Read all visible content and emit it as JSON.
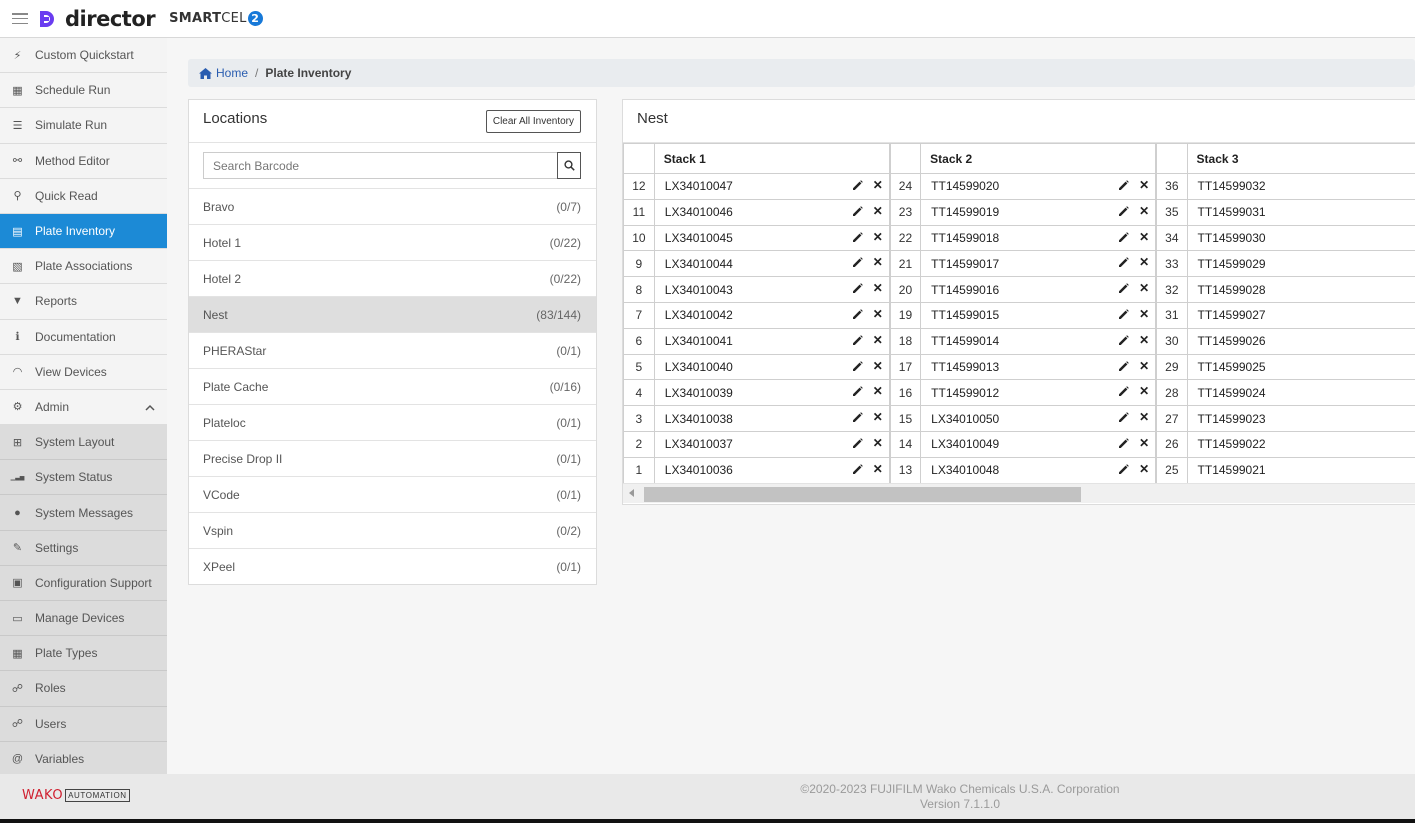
{
  "app": {
    "logo_text": "director",
    "product_name_bold": "SMART",
    "product_name_light": "CEL",
    "product_version_mark": "2"
  },
  "sidebar": {
    "items": [
      {
        "label": "Custom Quickstart",
        "icon": "bolt-icon",
        "glyph": "⚡"
      },
      {
        "label": "Schedule Run",
        "icon": "calendar-icon",
        "glyph": "▦"
      },
      {
        "label": "Simulate Run",
        "icon": "list-icon",
        "glyph": "☰"
      },
      {
        "label": "Method Editor",
        "icon": "sitemap-icon",
        "glyph": "⚯"
      },
      {
        "label": "Quick Read",
        "icon": "binoculars-icon",
        "glyph": "⚲"
      },
      {
        "label": "Plate Inventory",
        "icon": "inventory-icon",
        "glyph": "▤",
        "active": true
      },
      {
        "label": "Plate Associations",
        "icon": "file-icon",
        "glyph": "▧"
      },
      {
        "label": "Reports",
        "icon": "filter-icon",
        "glyph": "▼"
      },
      {
        "label": "Documentation",
        "icon": "info-icon",
        "glyph": "ℹ"
      },
      {
        "label": "View Devices",
        "icon": "wifi-icon",
        "glyph": "◠"
      },
      {
        "label": "Admin",
        "icon": "gear-icon",
        "glyph": "⚙",
        "expanded": true
      },
      {
        "label": "System Layout",
        "icon": "network-icon",
        "glyph": "⊞",
        "sub": true
      },
      {
        "label": "System Status",
        "icon": "signal-icon",
        "glyph": "▁▃▅",
        "sub": true
      },
      {
        "label": "System Messages",
        "icon": "comment-icon",
        "glyph": "●",
        "sub": true
      },
      {
        "label": "Settings",
        "icon": "wrench-icon",
        "glyph": "✎",
        "sub": true
      },
      {
        "label": "Configuration Support",
        "icon": "clipboard-icon",
        "glyph": "▣",
        "sub": true
      },
      {
        "label": "Manage Devices",
        "icon": "monitor-icon",
        "glyph": "▭",
        "sub": true
      },
      {
        "label": "Plate Types",
        "icon": "table-icon",
        "glyph": "▦",
        "sub": true
      },
      {
        "label": "Roles",
        "icon": "users-cog-icon",
        "glyph": "☍",
        "sub": true
      },
      {
        "label": "Users",
        "icon": "users-icon",
        "glyph": "☍",
        "sub": true
      },
      {
        "label": "Variables",
        "icon": "at-icon",
        "glyph": "@",
        "sub": true
      }
    ]
  },
  "breadcrumb": {
    "home": "Home",
    "separator": "/",
    "current": "Plate Inventory"
  },
  "locations": {
    "title": "Locations",
    "clear_button": "Clear All Inventory",
    "search_placeholder": "Search Barcode",
    "items": [
      {
        "name": "Bravo",
        "count": "(0/7)"
      },
      {
        "name": "Hotel 1",
        "count": "(0/22)"
      },
      {
        "name": "Hotel 2",
        "count": "(0/22)"
      },
      {
        "name": "Nest",
        "count": "(83/144)",
        "selected": true
      },
      {
        "name": "PHERAStar",
        "count": "(0/1)"
      },
      {
        "name": "Plate Cache",
        "count": "(0/16)"
      },
      {
        "name": "Plateloc",
        "count": "(0/1)"
      },
      {
        "name": "Precise Drop II",
        "count": "(0/1)"
      },
      {
        "name": "VCode",
        "count": "(0/1)"
      },
      {
        "name": "Vspin",
        "count": "(0/2)"
      },
      {
        "name": "XPeel",
        "count": "(0/1)"
      }
    ]
  },
  "nest": {
    "title": "Nest",
    "stacks": [
      {
        "name": "Stack 1",
        "rows": [
          {
            "pos": "12",
            "barcode": "LX34010047"
          },
          {
            "pos": "11",
            "barcode": "LX34010046"
          },
          {
            "pos": "10",
            "barcode": "LX34010045"
          },
          {
            "pos": "9",
            "barcode": "LX34010044"
          },
          {
            "pos": "8",
            "barcode": "LX34010043"
          },
          {
            "pos": "7",
            "barcode": "LX34010042"
          },
          {
            "pos": "6",
            "barcode": "LX34010041"
          },
          {
            "pos": "5",
            "barcode": "LX34010040"
          },
          {
            "pos": "4",
            "barcode": "LX34010039"
          },
          {
            "pos": "3",
            "barcode": "LX34010038"
          },
          {
            "pos": "2",
            "barcode": "LX34010037"
          },
          {
            "pos": "1",
            "barcode": "LX34010036"
          }
        ]
      },
      {
        "name": "Stack 2",
        "rows": [
          {
            "pos": "24",
            "barcode": "TT14599020"
          },
          {
            "pos": "23",
            "barcode": "TT14599019"
          },
          {
            "pos": "22",
            "barcode": "TT14599018"
          },
          {
            "pos": "21",
            "barcode": "TT14599017"
          },
          {
            "pos": "20",
            "barcode": "TT14599016"
          },
          {
            "pos": "19",
            "barcode": "TT14599015"
          },
          {
            "pos": "18",
            "barcode": "TT14599014"
          },
          {
            "pos": "17",
            "barcode": "TT14599013"
          },
          {
            "pos": "16",
            "barcode": "TT14599012"
          },
          {
            "pos": "15",
            "barcode": "LX34010050"
          },
          {
            "pos": "14",
            "barcode": "LX34010049"
          },
          {
            "pos": "13",
            "barcode": "LX34010048"
          }
        ]
      },
      {
        "name": "Stack 3",
        "rows": [
          {
            "pos": "36",
            "barcode": "TT14599032"
          },
          {
            "pos": "35",
            "barcode": "TT14599031"
          },
          {
            "pos": "34",
            "barcode": "TT14599030"
          },
          {
            "pos": "33",
            "barcode": "TT14599029"
          },
          {
            "pos": "32",
            "barcode": "TT14599028"
          },
          {
            "pos": "31",
            "barcode": "TT14599027"
          },
          {
            "pos": "30",
            "barcode": "TT14599026"
          },
          {
            "pos": "29",
            "barcode": "TT14599025"
          },
          {
            "pos": "28",
            "barcode": "TT14599024"
          },
          {
            "pos": "27",
            "barcode": "TT14599023"
          },
          {
            "pos": "26",
            "barcode": "TT14599022"
          },
          {
            "pos": "25",
            "barcode": "TT14599021"
          }
        ]
      }
    ]
  },
  "footer": {
    "brand": "WAKO",
    "brand_sub": "AUTOMATION",
    "copyright": "©2020-2023 FUJIFILM Wako Chemicals U.S.A. Corporation",
    "version": "Version 7.1.1.0"
  },
  "colors": {
    "accent": "#1c8ad6",
    "logo": "#6a3cf0",
    "brand_red": "#d02030"
  }
}
